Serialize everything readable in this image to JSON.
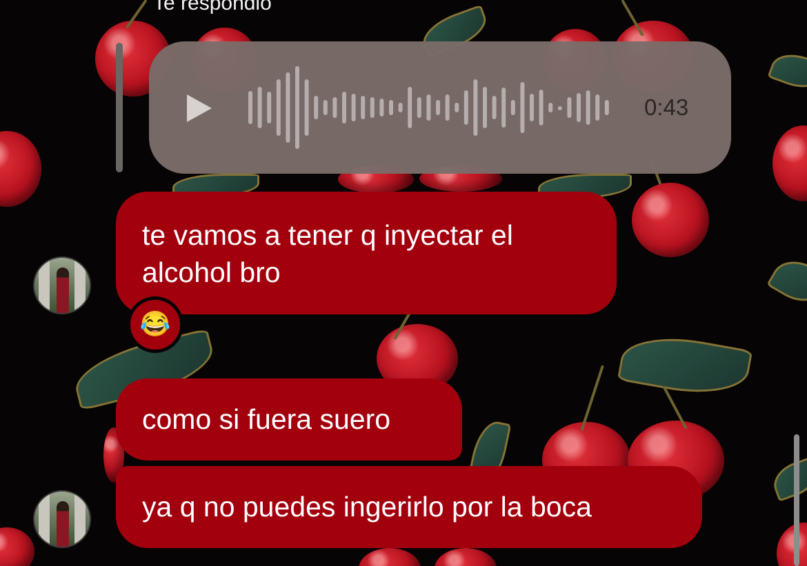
{
  "thread": {
    "reply_label": "Te respondió",
    "voice_message": {
      "duration": "0:43",
      "play_icon": "play-icon"
    },
    "messages": [
      {
        "text": "te vamos a tener q inyectar el alcohol bro",
        "reaction": "😂"
      },
      {
        "text": "como si fuera suero"
      },
      {
        "text": "ya q no puedes ingerirlo por la boca"
      }
    ]
  },
  "colors": {
    "background": "#070405",
    "message_bubble": "#a3000e",
    "voice_bubble": "#7a6c69",
    "message_text": "#ffffff"
  }
}
